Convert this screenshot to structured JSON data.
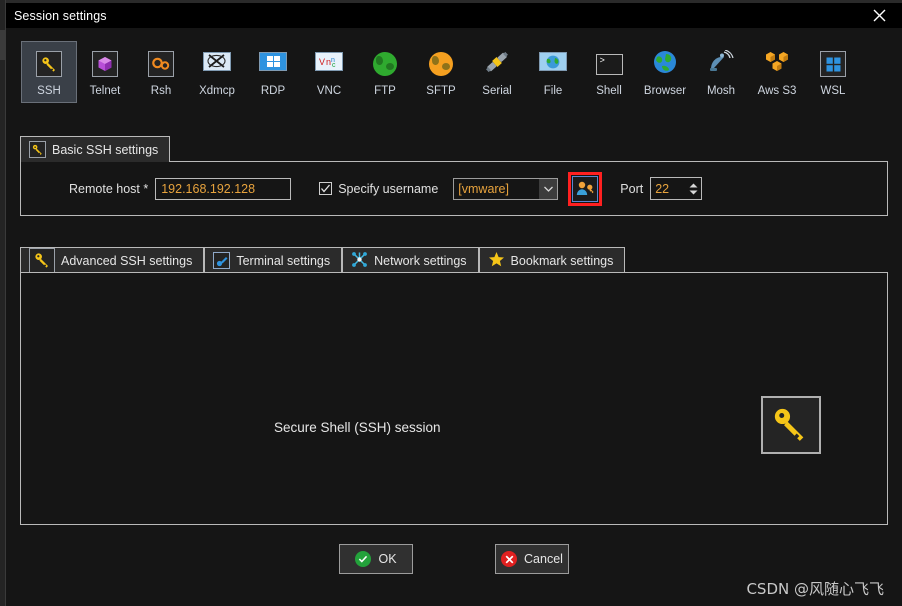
{
  "window": {
    "title": "Session settings",
    "close_icon": "close-icon"
  },
  "protocols": [
    {
      "id": "ssh",
      "label": "SSH",
      "icon": "key-icon",
      "selected": true
    },
    {
      "id": "telnet",
      "label": "Telnet",
      "icon": "purple-cube-icon",
      "selected": false
    },
    {
      "id": "rsh",
      "label": "Rsh",
      "icon": "orange-gears-icon",
      "selected": false
    },
    {
      "id": "xdmcp",
      "label": "Xdmcp",
      "icon": "x-monitor-icon",
      "selected": false
    },
    {
      "id": "rdp",
      "label": "RDP",
      "icon": "windows-monitor-icon",
      "selected": false
    },
    {
      "id": "vnc",
      "label": "VNC",
      "icon": "vnc-monitor-icon",
      "selected": false
    },
    {
      "id": "ftp",
      "label": "FTP",
      "icon": "green-globe-icon",
      "selected": false
    },
    {
      "id": "sftp",
      "label": "SFTP",
      "icon": "orange-globe-icon",
      "selected": false
    },
    {
      "id": "serial",
      "label": "Serial",
      "icon": "serial-plug-icon",
      "selected": false
    },
    {
      "id": "file",
      "label": "File",
      "icon": "file-monitor-icon",
      "selected": false
    },
    {
      "id": "shell",
      "label": "Shell",
      "icon": "terminal-prompt-icon",
      "selected": false
    },
    {
      "id": "browser",
      "label": "Browser",
      "icon": "blue-globe-icon",
      "selected": false
    },
    {
      "id": "mosh",
      "label": "Mosh",
      "icon": "satellite-dish-icon",
      "selected": false
    },
    {
      "id": "awss3",
      "label": "Aws S3",
      "icon": "aws-cubes-icon",
      "selected": false
    },
    {
      "id": "wsl",
      "label": "WSL",
      "icon": "windows-logo-icon",
      "selected": false
    }
  ],
  "basic_panel": {
    "tab_label": "Basic SSH settings",
    "tab_icon": "key-icon",
    "remote_host_label": "Remote host *",
    "remote_host_value": "192.168.192.128",
    "specify_username_label": "Specify username",
    "specify_username_checked": true,
    "username_value": "[vmware]",
    "username_options": [
      "[vmware]"
    ],
    "user_key_button_icon": "user-key-icon",
    "port_label": "Port",
    "port_value": "22"
  },
  "lower_tabs": [
    {
      "id": "advanced",
      "label": "Advanced SSH settings",
      "icon": "key-icon"
    },
    {
      "id": "terminal",
      "label": "Terminal settings",
      "icon": "terminal-blue-icon"
    },
    {
      "id": "network",
      "label": "Network settings",
      "icon": "network-nodes-icon"
    },
    {
      "id": "bookmark",
      "label": "Bookmark settings",
      "icon": "star-icon"
    }
  ],
  "content": {
    "session_text": "Secure Shell (SSH) session",
    "big_icon": "key-icon"
  },
  "buttons": {
    "ok_label": "OK",
    "ok_icon": "check-circle-icon",
    "cancel_label": "Cancel",
    "cancel_icon": "x-circle-icon"
  },
  "watermark": "CSDN @风随心飞飞",
  "colors": {
    "accent_value": "#e8a33d",
    "highlight_red": "#ff2020",
    "focus_blue": "#5b86d0",
    "selected_tab_bg": "#3a4048",
    "ok_green": "#23a23b",
    "cancel_red": "#e02020"
  }
}
